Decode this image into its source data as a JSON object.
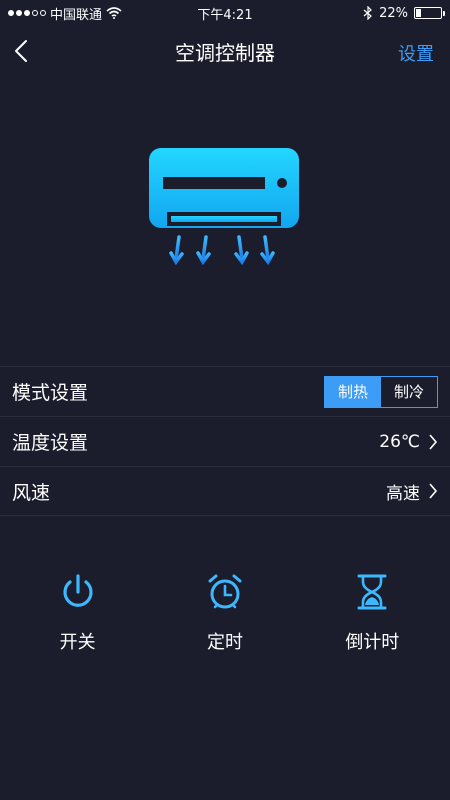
{
  "status_bar": {
    "carrier": "中国联通",
    "time": "下午4:21",
    "battery_text": "22%",
    "battery_level": 0.22
  },
  "nav": {
    "title": "空调控制器",
    "settings_label": "设置"
  },
  "settings": {
    "mode": {
      "label": "模式设置",
      "options": [
        "制热",
        "制冷"
      ],
      "selected": "制热"
    },
    "temperature": {
      "label": "温度设置",
      "value": "26℃"
    },
    "fan_speed": {
      "label": "风速",
      "value": "高速"
    }
  },
  "actions": [
    {
      "label": "开关",
      "icon": "power-icon"
    },
    {
      "label": "定时",
      "icon": "alarm-clock-icon"
    },
    {
      "label": "倒计时",
      "icon": "hourglass-icon"
    }
  ],
  "colors": {
    "background": "#1b1d2c",
    "accent": "#3d9cf5",
    "ac_cyan": "#1ec8ff"
  }
}
